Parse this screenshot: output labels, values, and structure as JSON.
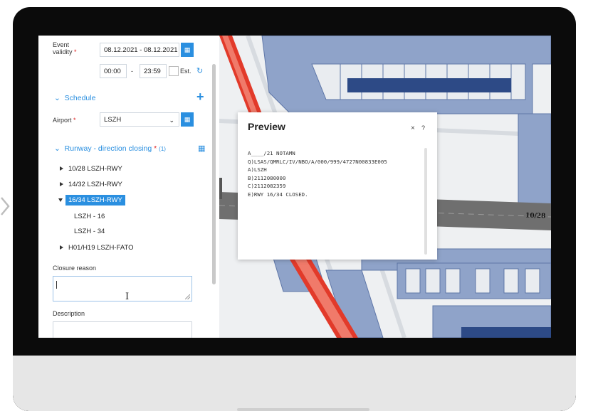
{
  "form": {
    "event_validity_label_1": "Event",
    "event_validity_label_2": "validity",
    "required_mark": "*",
    "date_range": "08.12.2021 - 08.12.2021",
    "time_from": "00:00",
    "time_sep": "-",
    "time_to": "23:59",
    "est_label": "Est.",
    "schedule_label": "Schedule",
    "airport_label": "Airport",
    "airport_value": "LSZH",
    "runway_label": "Runway - direction closing",
    "runway_count": "(1)",
    "closure_reason_label": "Closure reason",
    "description_label": "Description"
  },
  "tree": {
    "items": [
      {
        "label": "10/28 LSZH-RWY"
      },
      {
        "label": "14/32 LSZH-RWY"
      },
      {
        "label": "16/34 LSZH-RWY"
      },
      {
        "label": "LSZH - 16"
      },
      {
        "label": "LSZH - 34"
      },
      {
        "label": "H01/H19 LSZH-FATO"
      }
    ]
  },
  "preview": {
    "title": "Preview",
    "close": "×",
    "help": "?",
    "lines": [
      "A____/21 NOTAMN",
      "Q)LSAS/QMRLC/IV/NBO/A/000/999/4727N00833E005",
      "A)LSZH",
      "B)2112080000",
      "C)2112082359",
      "E)RWY 16/34 CLOSED."
    ]
  },
  "map": {
    "runway_label": "10/28"
  },
  "colors": {
    "accent": "#2a8fe0",
    "building": "#8fa3c9",
    "building_dark": "#2d4a86",
    "runway_red": "#e23a2a",
    "runway_gray": "#6f6f6f"
  }
}
